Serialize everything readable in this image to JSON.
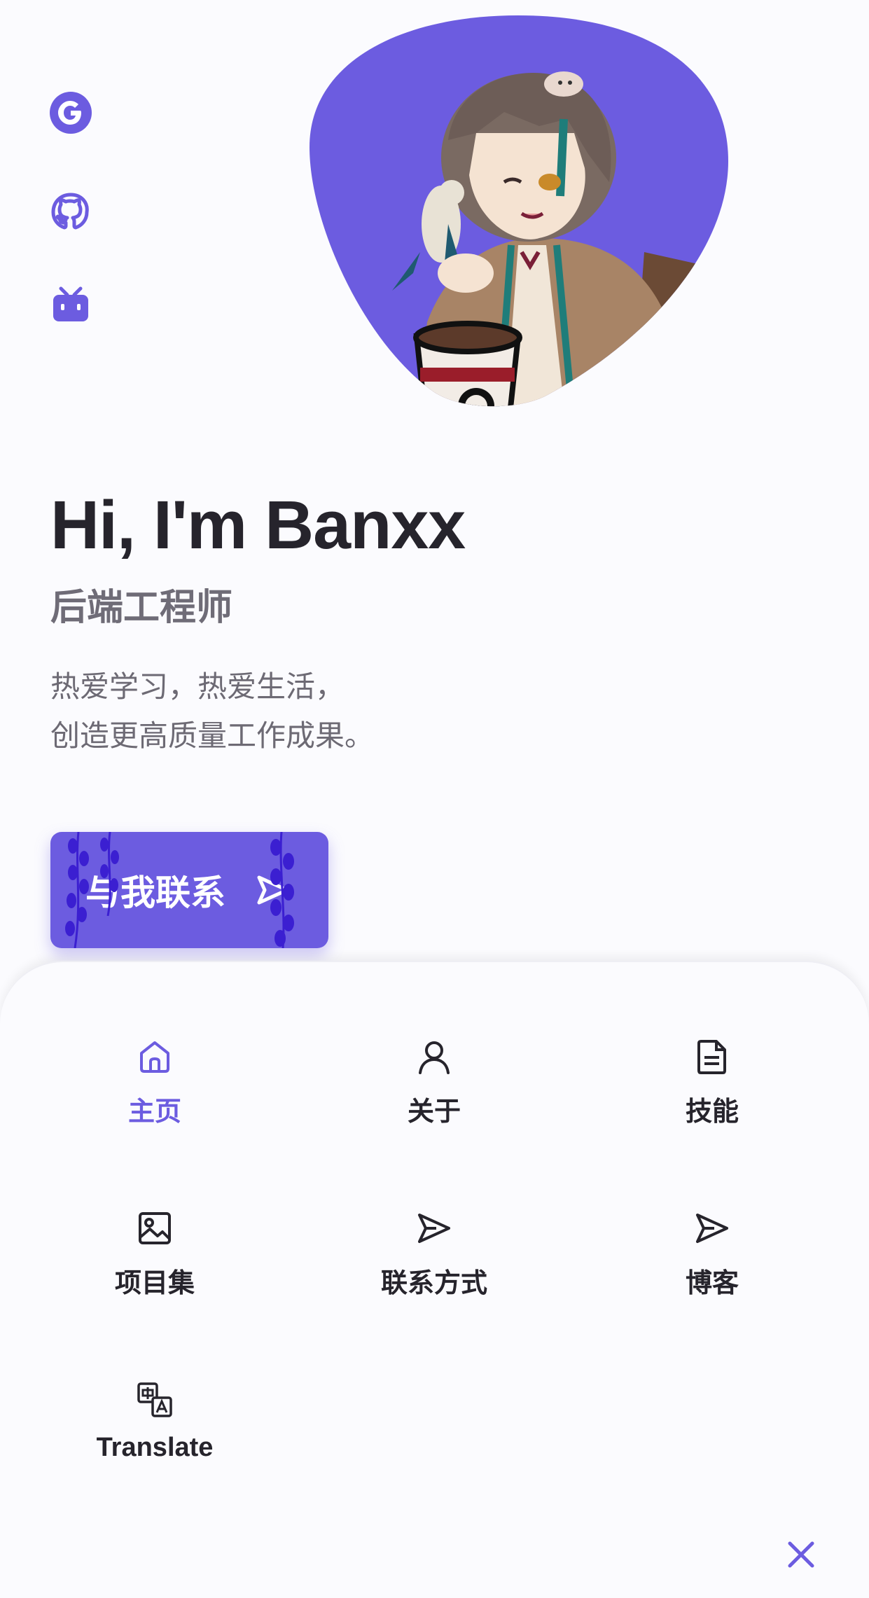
{
  "social": [
    "google-icon",
    "github-icon",
    "bilibili-icon"
  ],
  "hero": {
    "title": "Hi, I'm Banxx",
    "subtitle": "后端工程师",
    "desc_line1": "热爱学习，热爱生活，",
    "desc_line2": "创造更高质量工作成果。"
  },
  "cta": {
    "label": "与我联系"
  },
  "nav": {
    "home": "主页",
    "about": "关于",
    "skills": "技能",
    "projects": "项目集",
    "contact": "联系方式",
    "blog": "博客",
    "translate": "Translate"
  },
  "colors": {
    "accent": "#6c5ce0",
    "text": "#26242c",
    "muted": "#6d6a74"
  }
}
